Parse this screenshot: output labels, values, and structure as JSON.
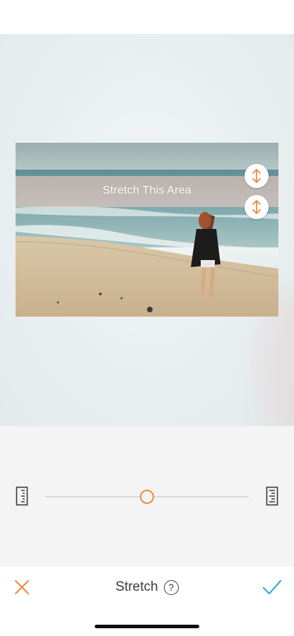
{
  "canvas": {
    "stretch_label": "Stretch This Area"
  },
  "icons": {
    "handle_top": "vertical-resize-icon",
    "handle_bottom": "vertical-resize-icon",
    "ruler_left": "ruler-icon",
    "ruler_right": "ruler-icon",
    "cancel": "close-icon",
    "confirm": "checkmark-icon",
    "help": "help-icon"
  },
  "slider": {
    "value_fraction": 0.5
  },
  "bottom_bar": {
    "title": "Stretch",
    "help_glyph": "?"
  },
  "colors": {
    "accent_orange": "#f08a3c",
    "confirm_blue": "#3aa8d8",
    "stretch_band": "#ffcdc3"
  }
}
